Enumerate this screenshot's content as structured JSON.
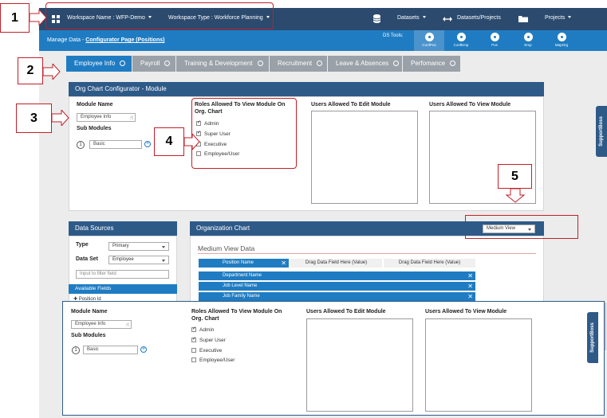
{
  "topbar": {
    "workspace_name": "Workspace Name : WFP-Demo",
    "workspace_type": "Workspace Type : Workforce Planning",
    "datasets": "Datasets",
    "datasets_projects": "Datasets/Projects",
    "projects": "Projects"
  },
  "subbar": {
    "breadcrumb_root": "Manage Data",
    "breadcrumb_sep": "-",
    "breadcrumb_current": "Configurator Page (Positions)",
    "ds_tools_label": "DS Tools:",
    "tools": [
      {
        "label": "ConfPos",
        "icon": "conf-pos-icon"
      },
      {
        "label": "ConfEmp",
        "icon": "conf-emp-icon"
      },
      {
        "label": "Pos",
        "icon": "pos-icon"
      },
      {
        "label": "Emp",
        "icon": "emp-icon"
      },
      {
        "label": "MapOrg",
        "icon": "map-org-icon"
      }
    ]
  },
  "tabs": [
    {
      "label": "Employee Info",
      "active": true
    },
    {
      "label": "Payroll",
      "active": false
    },
    {
      "label": "Training & Development",
      "active": false
    },
    {
      "label": "Recruitment",
      "active": false
    },
    {
      "label": "Leave & Absences",
      "active": false
    },
    {
      "label": "Perfomance",
      "active": false
    }
  ],
  "configurator": {
    "title": "Org Chart Configurator - Module",
    "module_name_label": "Module Name",
    "module_name_value": "Employee Info",
    "sub_modules_label": "Sub Modules",
    "sub_module_index": "1",
    "sub_module_value": "Basic",
    "roles_label_line1": "Roles Allowed To View Module On",
    "roles_label_line2": "Org. Chart",
    "roles": [
      {
        "label": "Admin",
        "checked": true
      },
      {
        "label": "Super User",
        "checked": true
      },
      {
        "label": "Executive",
        "checked": false
      },
      {
        "label": "Employee/User",
        "checked": false
      }
    ],
    "edit_users_label": "Users Allowed To Edit Module",
    "view_users_label": "Users Allowed To View Module"
  },
  "data_sources": {
    "title": "Data Sources",
    "type_label": "Type",
    "type_value": "Primary",
    "dataset_label": "Data Set",
    "dataset_value": "Employee",
    "filter_placeholder": "Input to filter field",
    "available_fields_label": "Available Fields",
    "first_field": "Position Id"
  },
  "org_chart": {
    "title": "Organization Chart",
    "view_select": "Medium View",
    "view_title": "Medium View Data",
    "position_name": "Position Name",
    "drag_value_1": "Drag Data Field Here (Value)",
    "drag_value_2": "Drag Data Field Here (Value)",
    "fields": [
      "Department Name",
      "Job Level Name",
      "Job Family Name"
    ]
  },
  "support": {
    "label": "SupportBoss"
  },
  "callouts": [
    "1",
    "2",
    "3",
    "4",
    "5"
  ],
  "colors": {
    "topbar": "#2b4a6e",
    "subbar": "#1f7cc2",
    "accent": "#1f7cc2",
    "annotation": "#c0202a"
  }
}
